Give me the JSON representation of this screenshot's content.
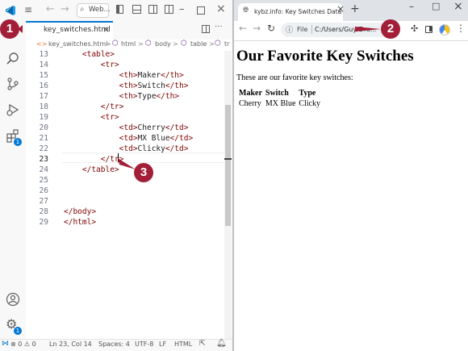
{
  "vscode": {
    "nav": {
      "search_text": "Web..."
    },
    "tab": {
      "filename": "key_switches.html",
      "close": "×"
    },
    "tab_actions": {
      "split": "◫",
      "more": "···"
    },
    "breadcrumbs": [
      "<> key_switches.html",
      "html",
      "body",
      "table",
      "tr"
    ],
    "breadcrumb_seps": [
      ">",
      ">",
      ">",
      ">"
    ],
    "editor": {
      "lines": [
        {
          "n": "13",
          "code": "    <table>"
        },
        {
          "n": "14",
          "code": "        <tr>"
        },
        {
          "n": "15",
          "code": "            <th>Maker</th>"
        },
        {
          "n": "16",
          "code": "            <th>Switch</th>"
        },
        {
          "n": "17",
          "code": "            <th>Type</th>"
        },
        {
          "n": "18",
          "code": "        </tr>"
        },
        {
          "n": "19",
          "code": "        <tr>"
        },
        {
          "n": "20",
          "code": "            <td>Cherry</td>"
        },
        {
          "n": "21",
          "code": "            <td>MX Blue</td>"
        },
        {
          "n": "22",
          "code": "            <td>Clicky</td>"
        },
        {
          "n": "23",
          "code": "        </tr>"
        },
        {
          "n": "24",
          "code": "    </table>"
        },
        {
          "n": "25",
          "code": ""
        },
        {
          "n": "26",
          "code": ""
        },
        {
          "n": "27",
          "code": ""
        },
        {
          "n": "28",
          "code": "</body>"
        },
        {
          "n": "29",
          "code": "</html>"
        }
      ],
      "active_line": "23"
    },
    "activity_badges": {
      "extensions": "1",
      "settings": "1"
    },
    "status": {
      "problems": "⊗ 0 ⚠ 0",
      "position": "Ln 23, Col 14",
      "spaces": "Spaces: 4",
      "encoding": "UTF-8",
      "eol": "LF",
      "language": "HTML"
    }
  },
  "browser": {
    "tab_title": "kybz.info: Key Switches Data",
    "tab_close": "×",
    "new_tab": "+",
    "window_controls": {
      "minimize": "–",
      "maximize": "□",
      "close": "×"
    },
    "omnibox": {
      "scheme": "File",
      "path": "C:/Users/Guy/Dro..."
    },
    "page": {
      "heading": "Our Favorite Key Switches",
      "intro": "These are our favorite key switches:",
      "table": {
        "headers": [
          "Maker",
          "Switch",
          "Type"
        ],
        "rows": [
          [
            "Cherry",
            "MX Blue",
            "Clicky"
          ]
        ]
      }
    }
  },
  "callouts": [
    "1",
    "2",
    "3"
  ],
  "colors": {
    "accent": "#0078d4",
    "callout": "#a31e38",
    "tag": "#800000"
  }
}
